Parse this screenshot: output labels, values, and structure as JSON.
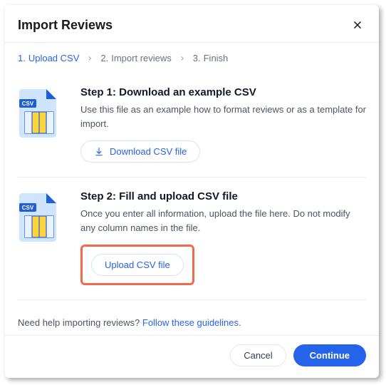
{
  "modal": {
    "title": "Import Reviews"
  },
  "stepper": {
    "steps": [
      {
        "num": "1.",
        "label": "Upload CSV"
      },
      {
        "num": "2.",
        "label": "Import reviews"
      },
      {
        "num": "3.",
        "label": "Finish"
      }
    ]
  },
  "section1": {
    "title": "Step 1: Download an example CSV",
    "desc": "Use this file as an example how to format reviews or as a template for import.",
    "button": "Download CSV file"
  },
  "section2": {
    "title": "Step 2: Fill and upload CSV file",
    "desc": "Once you enter all information, upload the file here. Do not modify any column names in the file.",
    "button": "Upload CSV file"
  },
  "help": {
    "text": "Need help importing reviews? ",
    "link": "Follow these guidelines."
  },
  "footer": {
    "cancel": "Cancel",
    "continue": "Continue"
  },
  "icons": {
    "csv_badge": "CSV"
  }
}
